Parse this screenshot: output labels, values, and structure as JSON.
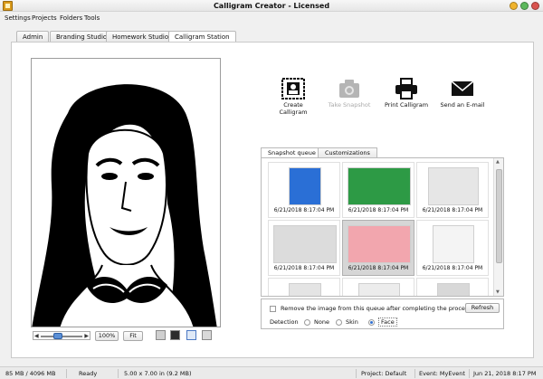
{
  "window": {
    "title": "Calligram Creator - Licensed"
  },
  "menu": [
    "Settings",
    "Projects",
    "Folders",
    "Tools"
  ],
  "tabs": [
    "Admin",
    "Branding Studio",
    "Homework Studio",
    "Calligram Station"
  ],
  "active_tab": "Calligram Station",
  "zoom": {
    "percent": "100%",
    "fit_label": "Fit"
  },
  "actions": {
    "create": "Create Calligram",
    "take": "Take Snapshot",
    "print": "Print Calligram",
    "send": "Send an E-mail"
  },
  "queue_tabs": [
    "Snapshot queue",
    "Customizations"
  ],
  "snapshots": [
    {
      "caption": "6/21/2018 8:17:04 PM",
      "color": "#2a6fd6"
    },
    {
      "caption": "6/21/2018 8:17:04 PM",
      "color": "#2d9a45"
    },
    {
      "caption": "6/21/2018 8:17:04 PM",
      "color": "#e6e6e6"
    },
    {
      "caption": "6/21/2018 8:17:04 PM",
      "color": "#dcdcdc"
    },
    {
      "caption": "6/21/2018 8:17:04 PM",
      "color": "#f2a6ae"
    },
    {
      "caption": "6/21/2018 8:17:04 PM",
      "color": "#f4f4f4"
    },
    {
      "caption": "",
      "color": "#e4e4e4"
    },
    {
      "caption": "",
      "color": "#ececec"
    },
    {
      "caption": "",
      "color": "#d8d8d8"
    }
  ],
  "options": {
    "remove_label": "Remove the image from this queue after completing the process",
    "refresh_label": "Refresh",
    "detection_label": "Detection",
    "detection_options": [
      "None",
      "Skin",
      "Face"
    ],
    "detection_selected": "Face"
  },
  "status": {
    "memory": "85 MB / 4096 MB",
    "state": "Ready",
    "size": "5.00 x 7.00 in  (9.2 MB)",
    "project": "Project: Default",
    "event": "Event: MyEvent",
    "datetime": "Jun 21, 2018   8:17 PM"
  }
}
